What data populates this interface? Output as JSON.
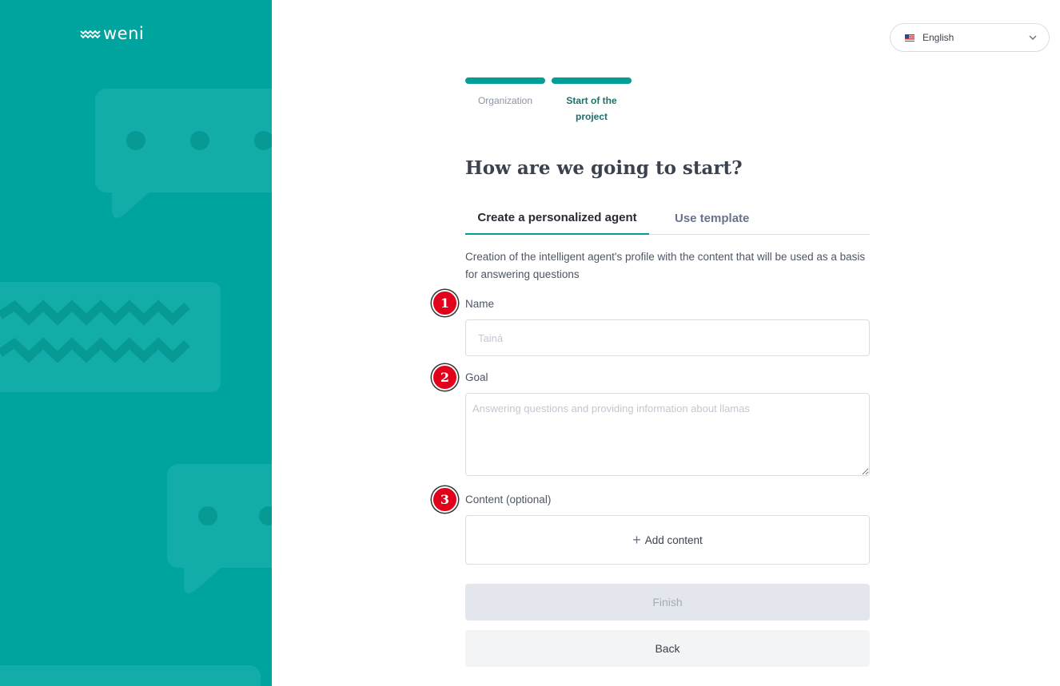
{
  "brand": {
    "name": "weni"
  },
  "language": {
    "selected": "English",
    "icon": "us-flag-icon"
  },
  "stepper": {
    "steps": [
      {
        "label": "Organization"
      },
      {
        "label": "Start of the project"
      }
    ]
  },
  "heading": "How are we going to start?",
  "tabs": [
    {
      "label": "Create a personalized agent"
    },
    {
      "label": "Use template"
    }
  ],
  "description": "Creation of the intelligent agent's profile with the content that will be used as a basis for answering questions",
  "form": {
    "name": {
      "label": "Name",
      "placeholder": "Tainá",
      "value": ""
    },
    "goal": {
      "label": "Goal",
      "placeholder": "Answering questions and providing information about llamas",
      "value": ""
    },
    "content": {
      "label": "Content (optional)",
      "add_label": "Add content"
    }
  },
  "markers": [
    "1",
    "2",
    "3"
  ],
  "buttons": {
    "finish": "Finish",
    "back": "Back"
  },
  "colors": {
    "panel": "#00a49f",
    "accent": "#009e96",
    "marker": "#e3001b"
  }
}
